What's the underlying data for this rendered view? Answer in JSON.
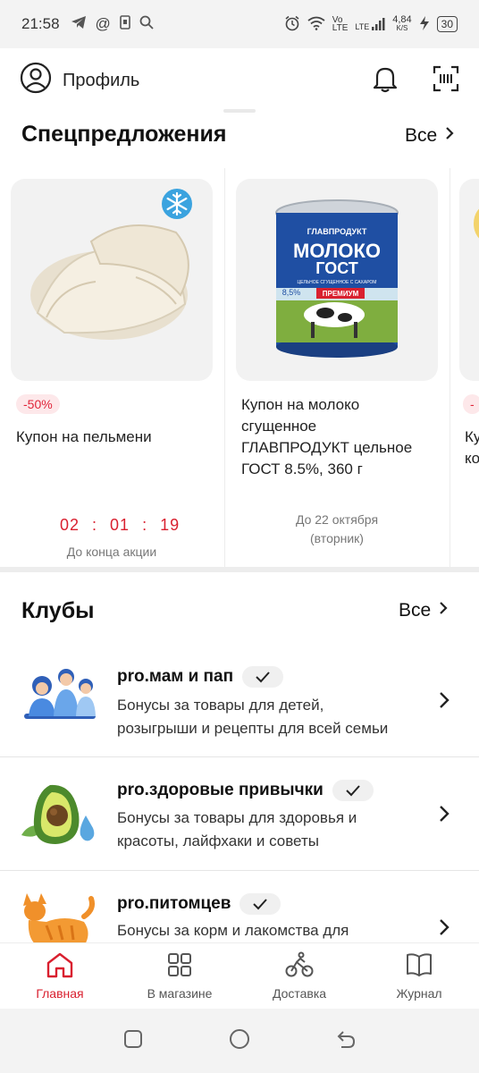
{
  "status_bar": {
    "time": "21:58",
    "net_speed": "4,84",
    "net_unit": "K/S",
    "vo": "Vo",
    "lte": "LTE",
    "battery": "30"
  },
  "header": {
    "profile_label": "Профиль"
  },
  "offers": {
    "title": "Спецпредложения",
    "all_label": "Все",
    "cards": [
      {
        "badge": "-50%",
        "title": "Купон на пельмени",
        "timer": [
          "02",
          "01",
          "19"
        ],
        "caption": "До конца акции"
      },
      {
        "title_lines": [
          "Купон на молоко",
          "сгущенное",
          "ГЛАВПРОДУКТ цельное",
          "ГОСТ 8.5%, 360 г"
        ],
        "caption_lines": [
          "До 22 октября",
          "(вторник)"
        ],
        "can": {
          "brand": "ГЛАВПРОДУКТ",
          "title1": "МОЛОКО",
          "title2": "ГОСТ",
          "sub": "ЦЕЛЬНОЕ СГУЩЕННОЕ С САХАРОМ",
          "pct": "8,5%",
          "premium": "ПРЕМИУМ"
        }
      },
      {
        "badge": "-",
        "title_lines": [
          "Куп",
          "ко"
        ]
      }
    ]
  },
  "clubs": {
    "title": "Клубы",
    "all_label": "Все",
    "items": [
      {
        "name": "pro.мам и пап",
        "desc_lines": [
          "Бонусы за товары для детей,",
          "розыгрыши и рецепты для всей семьи"
        ]
      },
      {
        "name": "pro.здоровые привычки",
        "desc_lines": [
          "Бонусы за товары для здоровья и",
          "красоты, лайфхаки и советы"
        ]
      },
      {
        "name": "pro.питомцев",
        "desc_lines": [
          "Бонусы за корм и лакомства для"
        ]
      }
    ]
  },
  "bottom_nav": {
    "items": [
      {
        "label": "Главная",
        "icon": "home-icon",
        "active": true
      },
      {
        "label": "В магазине",
        "icon": "grid-icon",
        "active": false
      },
      {
        "label": "Доставка",
        "icon": "cyclist-icon",
        "active": false
      },
      {
        "label": "Журнал",
        "icon": "book-icon",
        "active": false
      }
    ]
  },
  "colors": {
    "accent": "#d9202f",
    "badge_bg": "#fde8ea",
    "card_bg": "#f2f2f2"
  }
}
